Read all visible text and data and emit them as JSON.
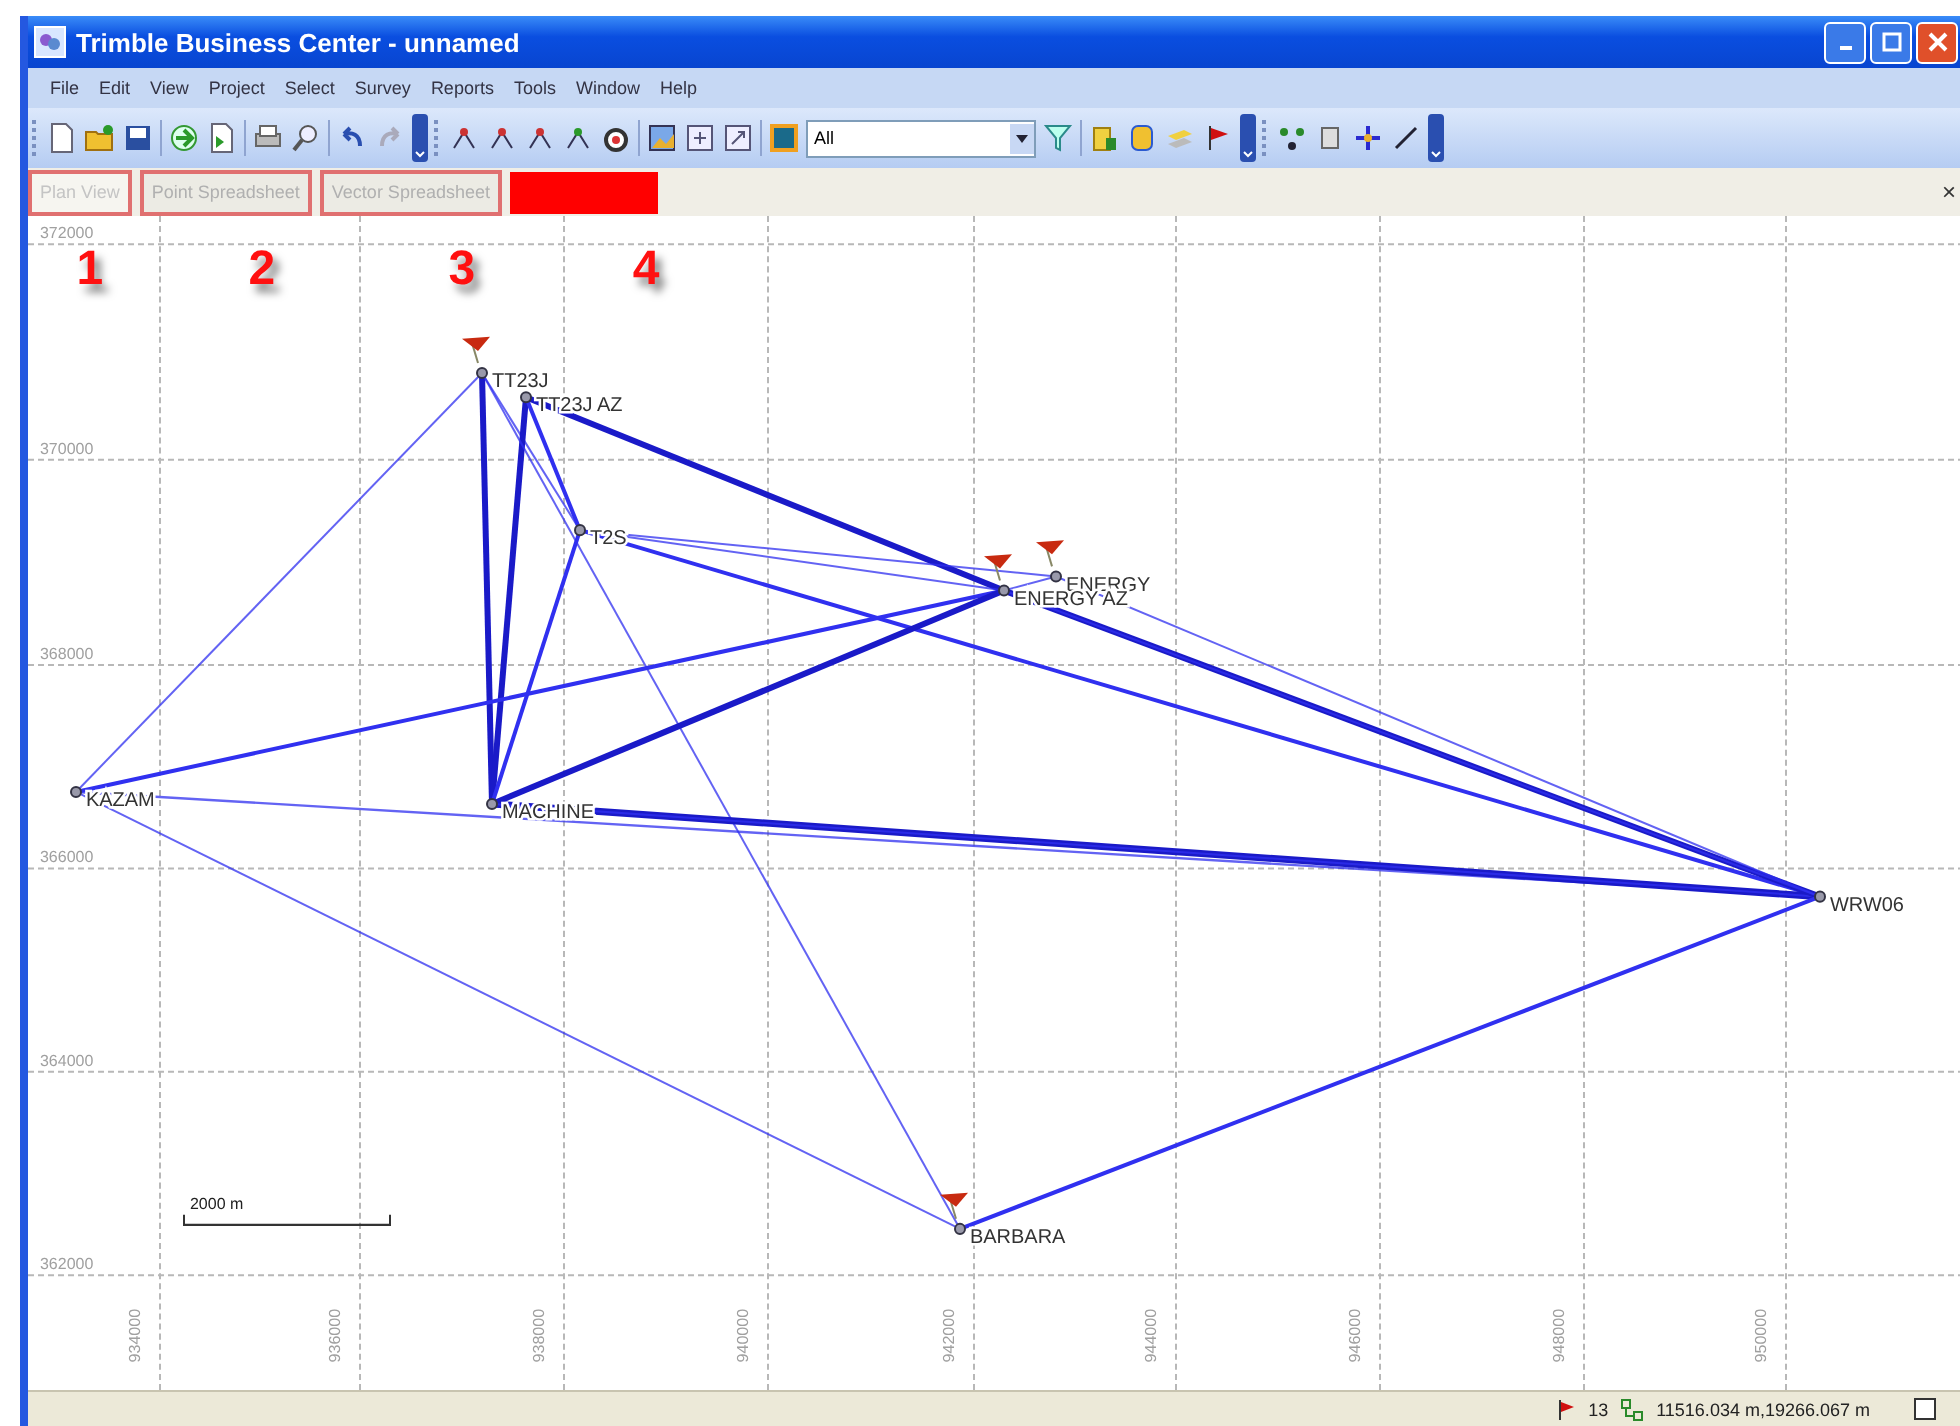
{
  "window": {
    "title": "Trimble Business Center - unnamed"
  },
  "menu": [
    "File",
    "Edit",
    "View",
    "Project",
    "Select",
    "Survey",
    "Reports",
    "Tools",
    "Window",
    "Help"
  ],
  "toolbar": {
    "filter": {
      "value": "All"
    }
  },
  "tabs": [
    {
      "kind": "tab",
      "label": "Plan View",
      "selected": true
    },
    {
      "kind": "tab",
      "label": "Point Spreadsheet",
      "selected": false
    },
    {
      "kind": "tab",
      "label": "Vector Spreadsheet",
      "selected": false
    },
    {
      "kind": "redacted"
    }
  ],
  "tab_close": "×",
  "map": {
    "y_labels": [
      "372000",
      "370000",
      "368000",
      "366000",
      "364000",
      "362000"
    ],
    "x_labels": [
      "934000",
      "936000",
      "938000",
      "940000",
      "942000",
      "944000",
      "946000",
      "948000",
      "950000"
    ],
    "points": [
      {
        "name": "TT23J",
        "flag": true
      },
      {
        "name": "TT23J AZ",
        "flag": false
      },
      {
        "name": "T2S",
        "flag": false
      },
      {
        "name": "ENERGY",
        "flag": true
      },
      {
        "name": "ENERGY AZ",
        "flag": true
      },
      {
        "name": "KAZAM",
        "flag": false
      },
      {
        "name": "MACHINE",
        "flag": false
      },
      {
        "name": "WRW06",
        "flag": false
      },
      {
        "name": "BARBARA",
        "flag": true
      }
    ],
    "scale": "2000 m",
    "callouts": [
      "1",
      "2",
      "3",
      "4"
    ]
  },
  "status_bar": {
    "count": "13",
    "coordinates": "11516.034 m,19266.067 m",
    "checkbox": {
      "checked": false
    }
  }
}
